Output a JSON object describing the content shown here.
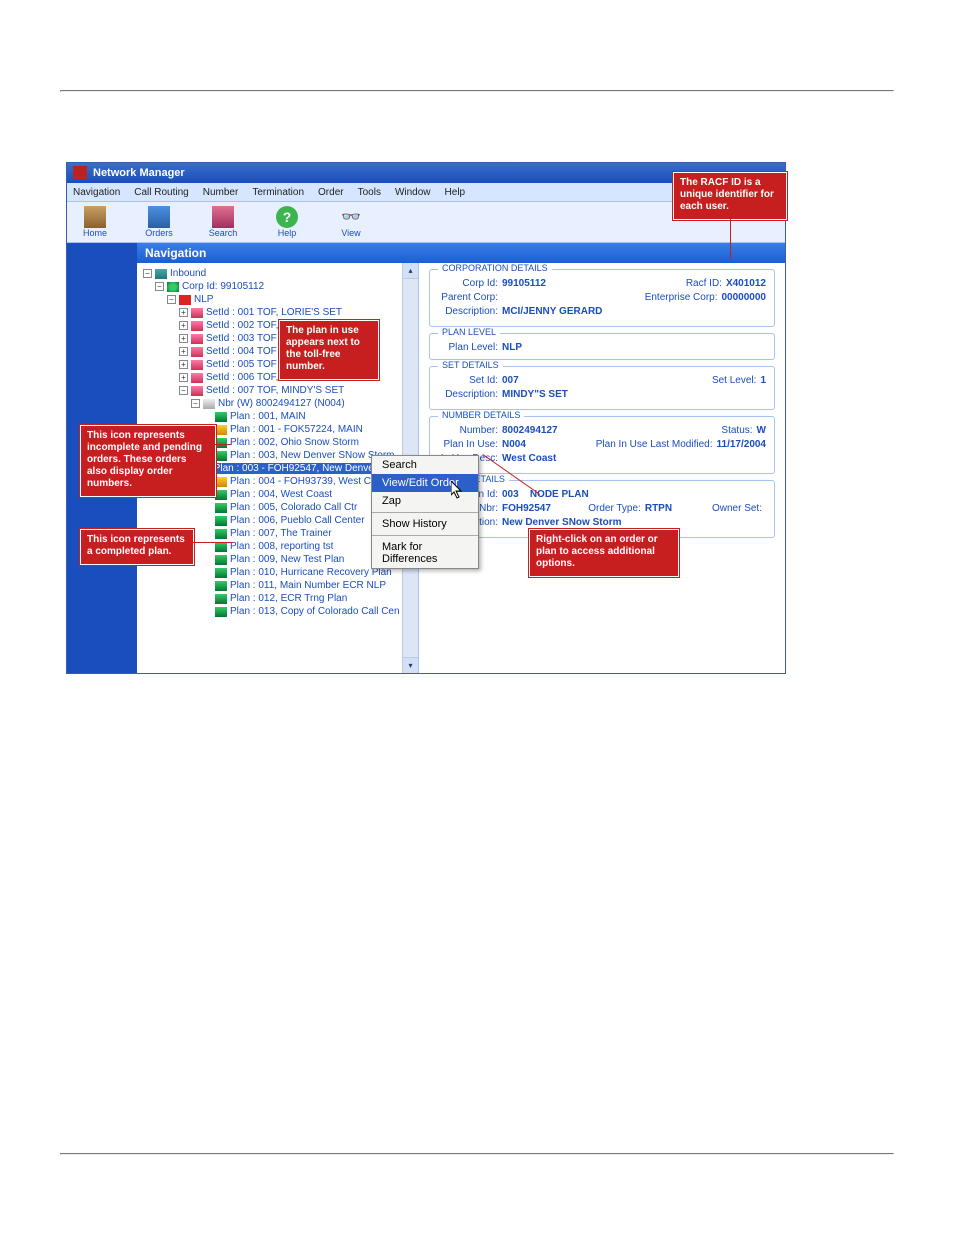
{
  "window": {
    "title": "Network Manager"
  },
  "menubar": [
    "Navigation",
    "Call Routing",
    "Number",
    "Termination",
    "Order",
    "Tools",
    "Window",
    "Help"
  ],
  "toolbar": [
    {
      "name": "home",
      "label": "Home"
    },
    {
      "name": "orders",
      "label": "Orders"
    },
    {
      "name": "search",
      "label": "Search"
    },
    {
      "name": "help",
      "label": "Help"
    },
    {
      "name": "view",
      "label": "View"
    }
  ],
  "nav_header": "Navigation",
  "tree": {
    "inbound": "Inbound",
    "corp": "Corp Id: 99105112",
    "nlp": "NLP",
    "sets": [
      "SetId : 001 TOF, LORIE'S SET",
      "SetId : 002 TOF, MARK'S SET",
      "SetId : 003 TOF",
      "SetId : 004 TOF",
      "SetId : 005 TOF",
      "SetId : 006 TOF, KIM'S SET",
      "SetId : 007 TOF, MINDY'S SET"
    ],
    "number": "Nbr (W) 8002494127 (N004)",
    "plans": [
      "Plan : 001, MAIN",
      "Plan : 001 - FOK57224, MAIN",
      "Plan : 002, Ohio Snow Storm",
      "Plan : 003, New Denver SNow Storm",
      "Plan : 003 - FOH92547, New Denver SNow S",
      "Plan : 004 - FOH93739, West C",
      "Plan : 004, West Coast",
      "Plan : 005, Colorado Call Ctr",
      "Plan : 006, Pueblo Call Center",
      "Plan : 007, The Trainer",
      "Plan : 008, reporting tst",
      "Plan : 009, New Test Plan",
      "Plan : 010, Hurricane Recovery Plan",
      "Plan : 011, Main Number ECR NLP",
      "Plan : 012, ECR Trng Plan",
      "Plan : 013, Copy of Colorado Call Cen"
    ]
  },
  "ctx_menu": [
    "Search",
    "View/Edit Order",
    "Zap",
    "Show History",
    "Mark for Differences"
  ],
  "details": {
    "corp": {
      "legend": "CORPORATION DETAILS",
      "corp_id_k": "Corp Id:",
      "corp_id_v": "99105112",
      "racf_k": "Racf ID:",
      "racf_v": "X401012",
      "parent_k": "Parent Corp:",
      "parent_v": "",
      "ent_k": "Enterprise Corp:",
      "ent_v": "00000000",
      "desc_k": "Description:",
      "desc_v": "MCI/JENNY GERARD"
    },
    "plan_level": {
      "legend": "PLAN LEVEL",
      "k": "Plan Level:",
      "v": "NLP"
    },
    "set": {
      "legend": "SET DETAILS",
      "id_k": "Set Id:",
      "id_v": "007",
      "lvl_k": "Set Level:",
      "lvl_v": "1",
      "desc_k": "Description:",
      "desc_v": "MINDY\"S SET"
    },
    "num": {
      "legend": "NUMBER DETAILS",
      "n_k": "Number:",
      "n_v": "8002494127",
      "st_k": "Status:",
      "st_v": "W",
      "piu_k": "Plan In Use:",
      "piu_v": "N004",
      "lm_k": "Plan In Use Last Modified:",
      "lm_v": "11/17/2004",
      "iud_k": "In Use Desc:",
      "iud_v": "West Coast"
    },
    "plan": {
      "legend": "PLAN DETAILS",
      "id_k": "Plan Id:",
      "id_v": "003",
      "np": "NODE PLAN",
      "on_k": "Order Nbr:",
      "on_v": "FOH92547",
      "ot_k": "Order Type:",
      "ot_v": "RTPN",
      "os_k": "Owner Set:",
      "os_v": "",
      "d_k": "Description:",
      "d_v": "New Denver SNow Storm"
    }
  },
  "callouts": {
    "racf": "The RACF ID is a unique identifier for each user.",
    "plan_in_use": "The plan in use appears next to the toll-free number.",
    "incomplete": "This icon represents incomplete and pending orders. These orders also display order numbers.",
    "completed": "This icon represents a completed plan.",
    "rightclick": "Right-click on an order or plan to access additional options."
  }
}
